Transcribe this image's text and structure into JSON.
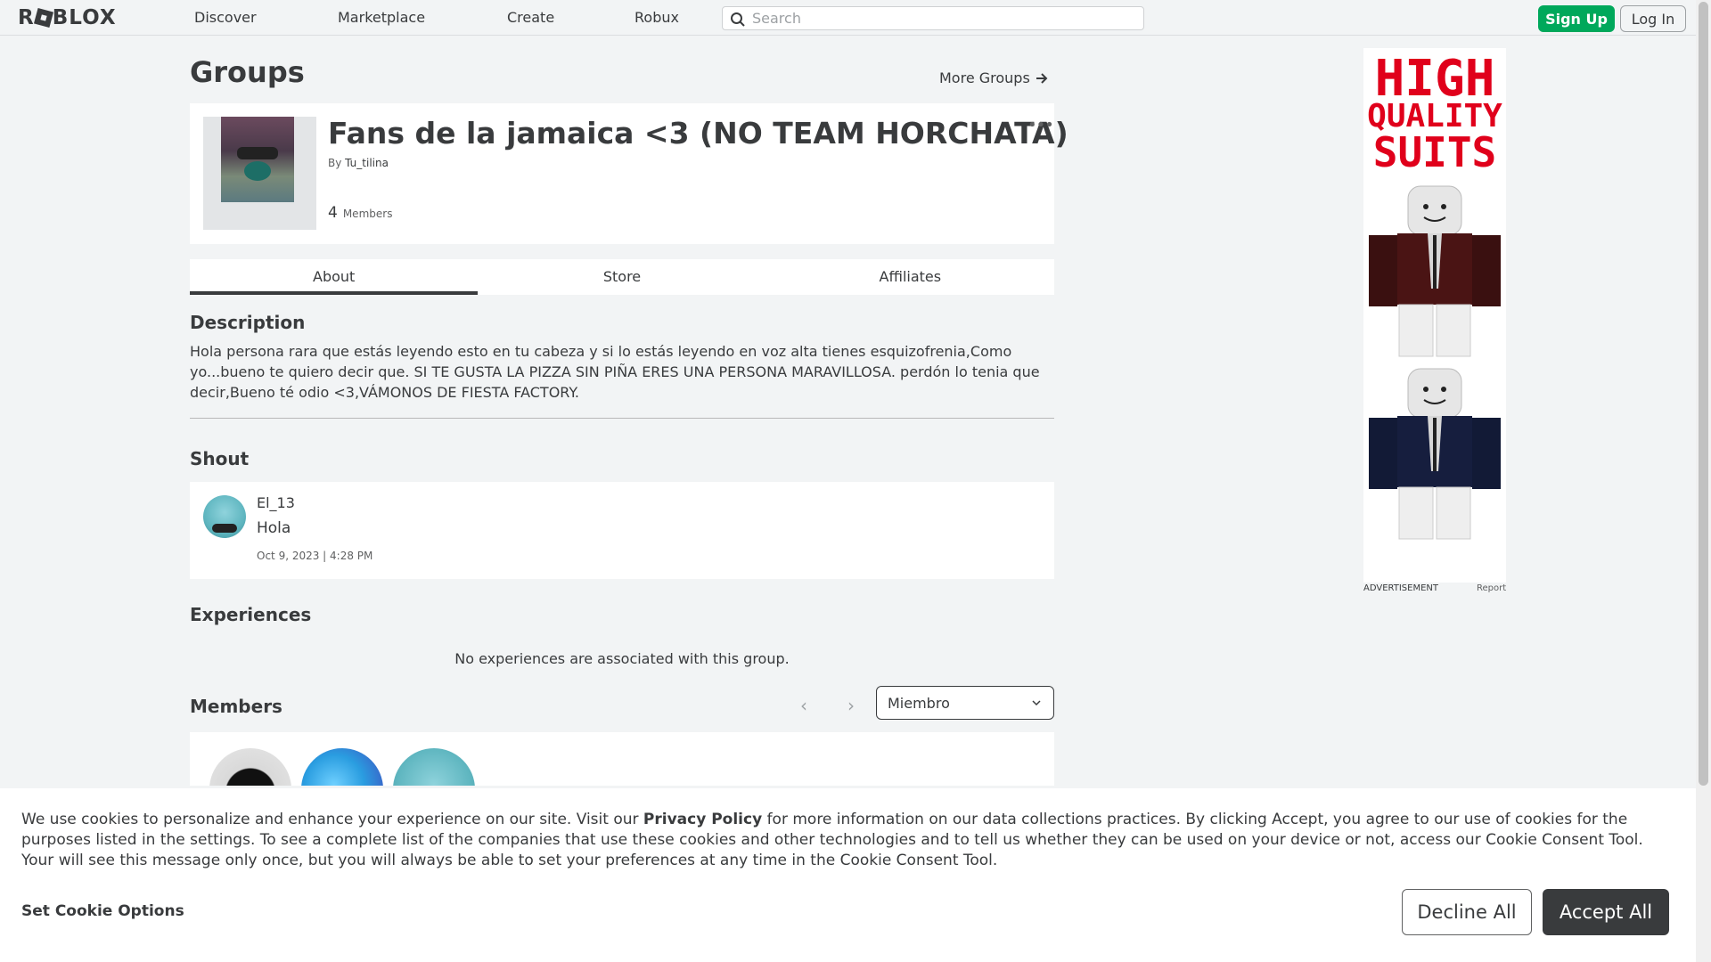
{
  "nav": {
    "logo": "ROBLOX",
    "links": [
      "Discover",
      "Marketplace",
      "Create",
      "Robux"
    ],
    "search_placeholder": "Search",
    "signup": "Sign Up",
    "login": "Log In"
  },
  "page": {
    "title": "Groups",
    "more_groups": "More Groups"
  },
  "group": {
    "name": "Fans de la jamaica <3 (NO TEAM HORCHATA)",
    "by_label": "By",
    "owner": "Tu_tilina",
    "member_count": "4",
    "member_label": "Members",
    "more": "..."
  },
  "tabs": [
    "About",
    "Store",
    "Affiliates"
  ],
  "description": {
    "heading": "Description",
    "text": "Hola persona rara que estás leyendo esto en tu cabeza y si lo estás leyendo en voz alta tienes esquizofrenia,Como yo...bueno te quiero decir que. SI TE GUSTA LA PIZZA SIN PIÑA ERES UNA PERSONA MARAVILLOSA. perdón lo tenia que decir,Bueno té odio <3,VÁMONOS DE FIESTA FACTORY."
  },
  "shout": {
    "heading": "Shout",
    "user": "El_13",
    "text": "Hola",
    "time": "Oct 9, 2023 | 4:28 PM"
  },
  "experiences": {
    "heading": "Experiences",
    "empty": "No experiences are associated with this group."
  },
  "members": {
    "heading": "Members",
    "role": "Miembro"
  },
  "ad": {
    "line1": "HIGH",
    "line2": "QUALITY",
    "line3": "SUITS",
    "label": "ADVERTISEMENT",
    "report": "Report"
  },
  "cookie": {
    "text_before": "We use cookies to personalize and enhance your experience on our site. Visit our ",
    "link": "Privacy Policy",
    "text_after": " for more information on our data collections practices. By clicking Accept, you agree to our use of cookies for the purposes listed in the settings. To see a complete list of the companies that use these cookies and other technologies and to tell us whether they can be used on your device or not, access our Cookie Consent Tool. Your will see this message only once, but you will always be able to set your preferences at any time in the Cookie Consent Tool.",
    "settings": "Set Cookie Options",
    "decline": "Decline All",
    "accept": "Accept All"
  }
}
